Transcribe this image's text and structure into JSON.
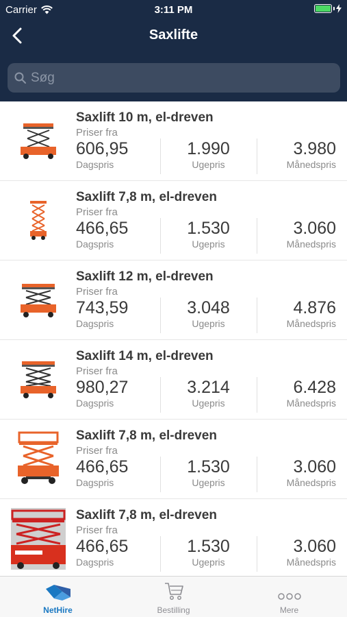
{
  "status": {
    "carrier": "Carrier",
    "time": "3:11 PM"
  },
  "nav": {
    "title": "Saxlifte"
  },
  "search": {
    "placeholder": "Søg"
  },
  "items": [
    {
      "name": "Saxlift 10 m, el-dreven",
      "from": "Priser fra",
      "day": "606,95",
      "week": "1.990",
      "month": "3.980",
      "day_label": "Dagspris",
      "week_label": "Ugepris",
      "month_label": "Månedspris"
    },
    {
      "name": "Saxlift 7,8 m, el-dreven",
      "from": "Priser fra",
      "day": "466,65",
      "week": "1.530",
      "month": "3.060",
      "day_label": "Dagspris",
      "week_label": "Ugepris",
      "month_label": "Månedspris"
    },
    {
      "name": "Saxlift 12 m, el-dreven",
      "from": "Priser fra",
      "day": "743,59",
      "week": "3.048",
      "month": "4.876",
      "day_label": "Dagspris",
      "week_label": "Ugepris",
      "month_label": "Månedspris"
    },
    {
      "name": "Saxlift 14 m, el-dreven",
      "from": "Priser fra",
      "day": "980,27",
      "week": "3.214",
      "month": "6.428",
      "day_label": "Dagspris",
      "week_label": "Ugepris",
      "month_label": "Månedspris"
    },
    {
      "name": "Saxlift 7,8 m, el-dreven",
      "from": "Priser fra",
      "day": "466,65",
      "week": "1.530",
      "month": "3.060",
      "day_label": "Dagspris",
      "week_label": "Ugepris",
      "month_label": "Månedspris"
    },
    {
      "name": "Saxlift 7,8 m, el-dreven",
      "from": "Priser fra",
      "day": "466,65",
      "week": "1.530",
      "month": "3.060",
      "day_label": "Dagspris",
      "week_label": "Ugepris",
      "month_label": "Månedspris"
    }
  ],
  "tabs": [
    {
      "label": "NetHire",
      "icon": "nethire-logo-icon",
      "active": true
    },
    {
      "label": "Bestilling",
      "icon": "cart-icon",
      "active": false
    },
    {
      "label": "Mere",
      "icon": "more-icon",
      "active": false
    }
  ],
  "colors": {
    "header": "#1a2b45",
    "accent": "#1a78c2",
    "lift_orange": "#e8632a",
    "battery": "#4cd964"
  }
}
